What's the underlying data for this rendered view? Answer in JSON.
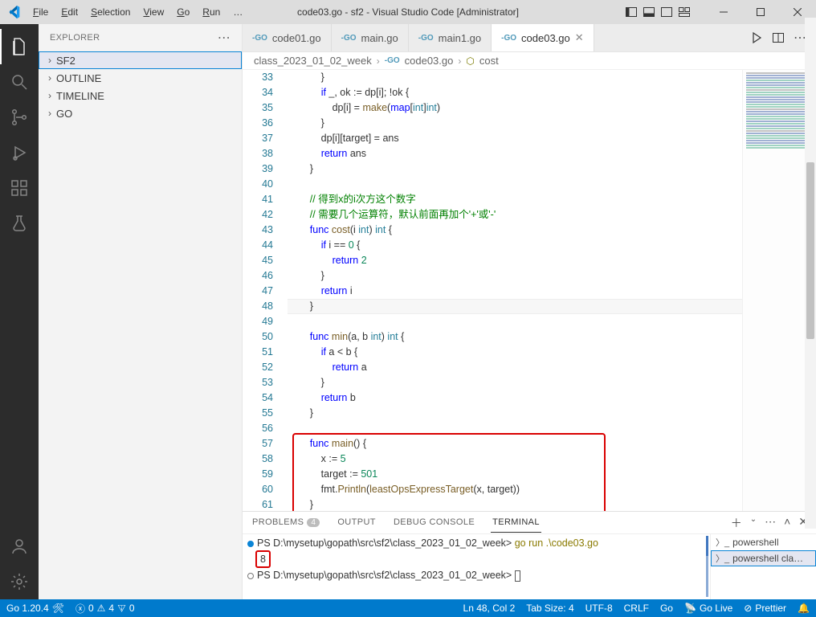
{
  "title": "code03.go - sf2 - Visual Studio Code [Administrator]",
  "menus": [
    "File",
    "Edit",
    "Selection",
    "View",
    "Go",
    "Run",
    "…"
  ],
  "menu_underline_idx": [
    0,
    0,
    0,
    0,
    0,
    0,
    -1
  ],
  "explorer": {
    "title": "EXPLORER",
    "sections": [
      {
        "label": "SF2",
        "expanded": false,
        "selected": true
      },
      {
        "label": "OUTLINE",
        "expanded": false
      },
      {
        "label": "TIMELINE",
        "expanded": false
      },
      {
        "label": "GO",
        "expanded": false
      }
    ]
  },
  "tabs": [
    {
      "label": "code01.go",
      "icon": "go",
      "active": false
    },
    {
      "label": "main.go",
      "icon": "go",
      "active": false
    },
    {
      "label": "main1.go",
      "icon": "go",
      "active": false
    },
    {
      "label": "code03.go",
      "icon": "go",
      "active": true
    }
  ],
  "breadcrumbs": [
    "class_2023_01_02_week",
    "code03.go",
    "cost"
  ],
  "code": {
    "first_line": 33,
    "current_line": 48,
    "red_box": {
      "from": 57,
      "to": 61
    },
    "lines": [
      "            }",
      "            if _, ok := dp[i]; !ok {",
      "                dp[i] = make(map[int]int)",
      "            }",
      "            dp[i][target] = ans",
      "            return ans",
      "        }",
      "",
      "        // 得到x的i次方这个数字",
      "        // 需要几个运算符，默认前面再加个'+'或'-'",
      "        func cost(i int) int {",
      "            if i == 0 {",
      "                return 2",
      "            }",
      "            return i",
      "        }",
      "",
      "        func min(a, b int) int {",
      "            if a < b {",
      "                return a",
      "            }",
      "            return b",
      "        }",
      "",
      "        func main() {",
      "            x := 5",
      "            target := 501",
      "            fmt.Println(leastOpsExpressTarget(x, target))",
      "        }"
    ]
  },
  "panel": {
    "tabs": [
      {
        "label": "PROBLEMS",
        "badge": "4"
      },
      {
        "label": "OUTPUT"
      },
      {
        "label": "DEBUG CONSOLE"
      },
      {
        "label": "TERMINAL",
        "active": true
      }
    ],
    "terminal": {
      "prompt_path": "D:\\mysetup\\gopath\\src\\sf2\\class_2023_01_02_week",
      "cmd": "go run .\\code03.go",
      "output": "8"
    },
    "terminals_side": [
      {
        "label": "powershell",
        "active": false
      },
      {
        "label": "powershell  cla…",
        "active": true
      }
    ]
  },
  "status": {
    "go_version": "Go 1.20.4",
    "errors": "0",
    "warnings": "4",
    "info": "0",
    "ln_col": "Ln 48, Col 2",
    "tab_size": "Tab Size: 4",
    "encoding": "UTF-8",
    "eol": "CRLF",
    "lang": "Go",
    "golive": "Go Live",
    "prettier": "Prettier",
    "bell": ""
  }
}
